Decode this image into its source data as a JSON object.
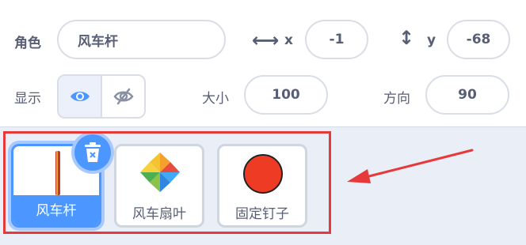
{
  "sprite_info": {
    "sprite_label": "角色",
    "sprite_name": "风车杆",
    "x_label": "x",
    "x_value": "-1",
    "y_label": "y",
    "y_value": "-68",
    "show_label": "显示",
    "size_label": "大小",
    "size_value": "100",
    "direction_label": "方向",
    "direction_value": "90"
  },
  "sprites": [
    {
      "name": "风车杆",
      "selected": true,
      "icon": "pole-thumbnail"
    },
    {
      "name": "风车扇叶",
      "selected": false,
      "icon": "pinwheel-thumbnail"
    },
    {
      "name": "固定钉子",
      "selected": false,
      "icon": "red-circle-thumbnail"
    }
  ],
  "colors": {
    "accent": "#4c97ff",
    "annotation": "#e63a3a",
    "text": "#575e75"
  }
}
